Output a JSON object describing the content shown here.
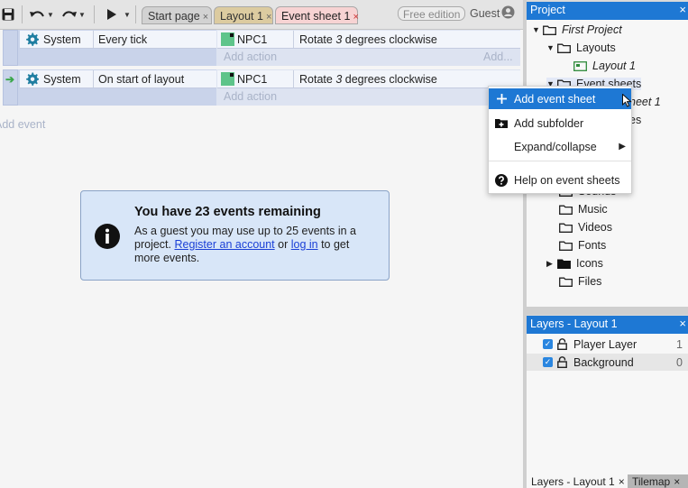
{
  "toolbar": {
    "tabs": [
      {
        "label": "Start page"
      },
      {
        "label": "Layout 1"
      },
      {
        "label": "Event sheet 1"
      }
    ],
    "close_glyph": "×",
    "free_edition": "Free edition",
    "guest": "Guest"
  },
  "events": [
    {
      "object": "System",
      "condition": "Every tick",
      "action_object": "NPC1",
      "action_pre": "Rotate ",
      "action_value": "3",
      "action_post": " degrees clockwise",
      "add_action": "Add action",
      "add_action_right": "Add..."
    },
    {
      "object": "System",
      "condition": "On start of layout",
      "action_object": "NPC1",
      "action_pre": "Rotate ",
      "action_value": "3",
      "action_post": " degrees clockwise",
      "add_action": "Add action"
    }
  ],
  "add_event": "Add event",
  "info_box": {
    "title": "You have 23 events remaining",
    "body_1": "As a guest you may use up to 25 events in a project. ",
    "link_register": "Register an account",
    "body_2": " or ",
    "link_login": "log in",
    "body_3": " to get more events."
  },
  "project_panel": {
    "title": "Project",
    "tree": [
      {
        "label": "First Project"
      },
      {
        "label": "Layouts"
      },
      {
        "label": "Layout 1"
      },
      {
        "label": "Event sheets"
      },
      {
        "label": "heet 1"
      },
      {
        "label": "es"
      },
      {
        "label": "Sounds"
      },
      {
        "label": "Music"
      },
      {
        "label": "Videos"
      },
      {
        "label": "Fonts"
      },
      {
        "label": "Icons"
      },
      {
        "label": "Files"
      }
    ]
  },
  "context_menu": [
    {
      "label": "Add event sheet",
      "icon": "plus-icon",
      "selected": true
    },
    {
      "label": "Add subfolder",
      "icon": "folder-plus-icon"
    },
    {
      "label": "Expand/collapse",
      "icon": "",
      "submenu": true
    },
    {
      "label": "Help on event sheets",
      "icon": "help-icon"
    }
  ],
  "layers_panel": {
    "title": "Layers - Layout 1",
    "layers": [
      {
        "name": "Player Layer",
        "index": "1"
      },
      {
        "name": "Background",
        "index": "0"
      }
    ]
  },
  "bottom_tabs": [
    {
      "label": "Layers - Layout 1"
    },
    {
      "label": "Tilemap"
    }
  ],
  "colors": {
    "accent": "#1e78d4",
    "event_bg": "#c9d3ea",
    "info_bg": "#d8e6f8"
  }
}
